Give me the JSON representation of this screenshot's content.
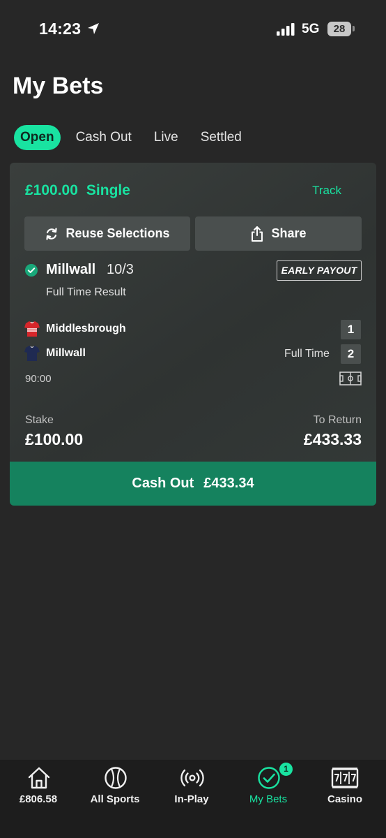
{
  "status_bar": {
    "time": "14:23",
    "network": "5G",
    "battery": "28"
  },
  "header": {
    "title": "My Bets"
  },
  "tabs": [
    {
      "label": "Open",
      "active": true
    },
    {
      "label": "Cash Out",
      "active": false
    },
    {
      "label": "Live",
      "active": false
    },
    {
      "label": "Settled",
      "active": false
    }
  ],
  "bet": {
    "stake_amount": "£100.00",
    "bet_type": "Single",
    "track_label": "Track",
    "reuse_label": "Reuse Selections",
    "share_label": "Share",
    "selection": "Millwall",
    "odds": "10/3",
    "early_payout_label": "EARLY PAYOUT",
    "market": "Full Time Result",
    "home_team": "Middlesbrough",
    "home_score": "1",
    "away_team": "Millwall",
    "away_score": "2",
    "match_status": "Full Time",
    "match_clock": "90:00",
    "stake_label": "Stake",
    "stake_value": "£100.00",
    "return_label": "To Return",
    "return_value": "£433.33",
    "cashout_label": "Cash Out",
    "cashout_value": "£433.34"
  },
  "bottom_nav": [
    {
      "label": "£806.58",
      "icon": "home-icon"
    },
    {
      "label": "All Sports",
      "icon": "ball-icon"
    },
    {
      "label": "In-Play",
      "icon": "broadcast-icon"
    },
    {
      "label": "My Bets",
      "icon": "check-circle-icon",
      "badge": "1",
      "active": true
    },
    {
      "label": "Casino",
      "icon": "slot-machine-icon"
    }
  ],
  "colors": {
    "accent": "#19e3a1",
    "cashout": "#15825e",
    "background": "#272727",
    "card": "#353a38",
    "nav": "#1d1d1d",
    "home_kit": "#d6262b",
    "away_kit": "#1f2a52"
  }
}
